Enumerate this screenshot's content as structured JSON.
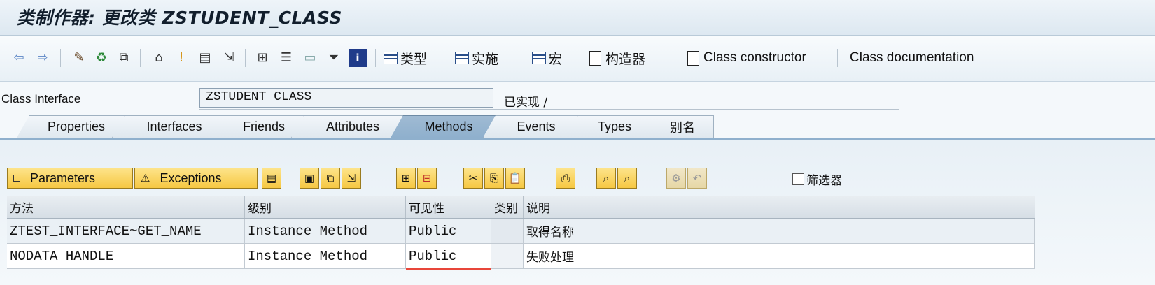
{
  "window": {
    "title": "类制作器: 更改类 ZSTUDENT_CLASS"
  },
  "toolbar": {
    "icons": [
      "back-arrow-icon",
      "forward-arrow-icon",
      "check-icon",
      "activate-icon",
      "where-used-icon",
      "hierarchy-icon",
      "marker-icon",
      "display-icon",
      "navigate-icon",
      "tree-icon",
      "list-icon",
      "frame-icon",
      "filter-icon",
      "info-icon"
    ],
    "buttons": {
      "types": "类型",
      "impl": "实施",
      "macro": "宏",
      "constructor_cn": "构造器",
      "class_constructor": "Class constructor",
      "class_documentation": "Class documentation"
    }
  },
  "class_interface": {
    "label": "Class Interface",
    "value": "ZSTUDENT_CLASS",
    "status": "已实现 /"
  },
  "tabs": [
    {
      "label": "Properties"
    },
    {
      "label": "Interfaces"
    },
    {
      "label": "Friends"
    },
    {
      "label": "Attributes"
    },
    {
      "label": "Methods",
      "active": true
    },
    {
      "label": "Events"
    },
    {
      "label": "Types"
    },
    {
      "label": "别名"
    }
  ],
  "method_toolbar": {
    "parameters": "Parameters",
    "exceptions": "Exceptions",
    "filter_label": "筛选器"
  },
  "table": {
    "headers": [
      "方法",
      "级别",
      "可见性",
      "类别",
      "说明"
    ],
    "rows": [
      [
        "ZTEST_INTERFACE~GET_NAME",
        "Instance Method",
        "Public",
        "",
        "取得名称"
      ],
      [
        "NODATA_HANDLE",
        "Instance Method",
        "Public",
        "",
        "失败处理"
      ]
    ]
  },
  "colors": {
    "accent_tab": "#8fb0cd",
    "button_yellow": "#f6c842",
    "mark_red": "#e8463a"
  }
}
